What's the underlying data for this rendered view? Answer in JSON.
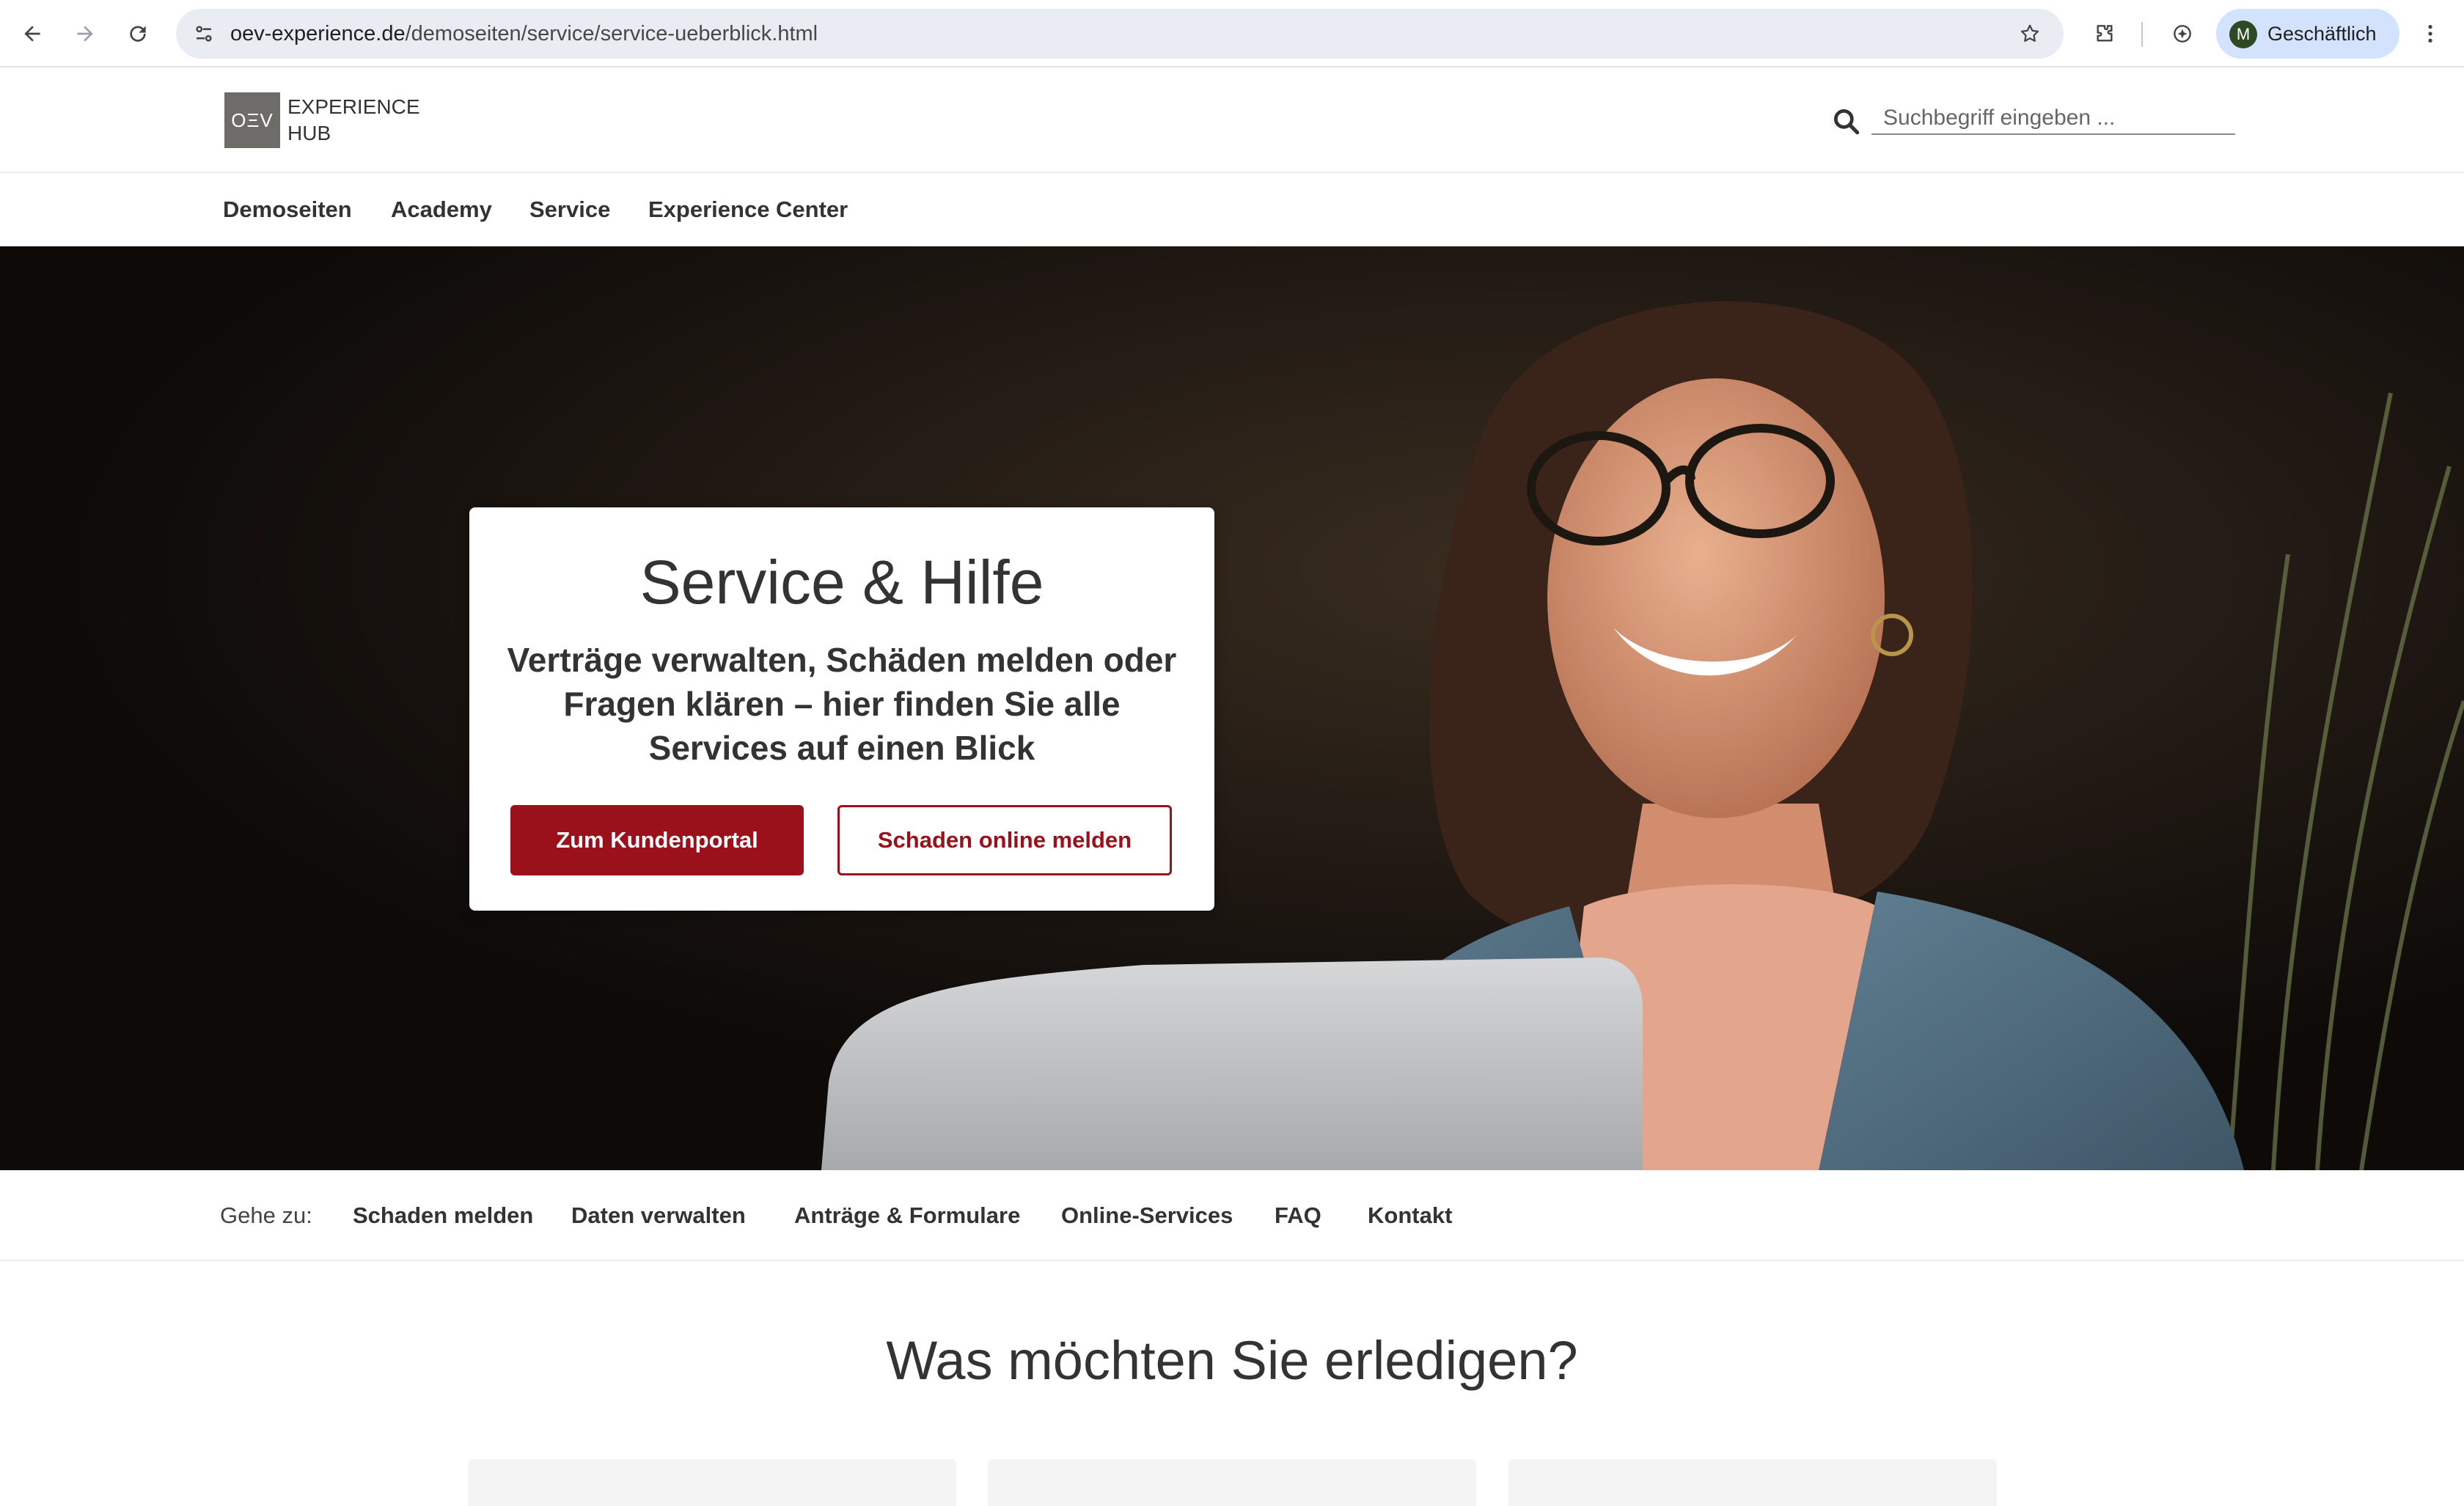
{
  "browser": {
    "url_host": "oev-experience.de",
    "url_path": "/demoseiten/service/service-ueberblick.html",
    "profile_initial": "M",
    "profile_name": "Geschäftlich"
  },
  "header": {
    "logo_mark": "OΞV",
    "logo_line1": "EXPERIENCE",
    "logo_line2": "HUB",
    "search_placeholder": "Suchbegriff eingeben ..."
  },
  "nav": {
    "items": [
      "Demoseiten",
      "Academy",
      "Service",
      "Experience Center"
    ]
  },
  "hero": {
    "title": "Service & Hilfe",
    "subtitle": "Verträge verwalten, Schäden melden oder Fragen klären – hier finden Sie alle Services auf einen Blick",
    "primary_button": "Zum Kundenportal",
    "secondary_button": "Schaden online melden"
  },
  "jump": {
    "label": "Gehe zu:",
    "items": [
      "Schaden melden",
      "Daten verwalten",
      "Anträge & Formulare",
      "Online-Services",
      "FAQ",
      "Kontakt"
    ]
  },
  "section": {
    "title": "Was möchten Sie erledigen?"
  },
  "colors": {
    "brand_red": "#9a111b",
    "logo_gray": "#6d6c69",
    "text": "#333333"
  }
}
